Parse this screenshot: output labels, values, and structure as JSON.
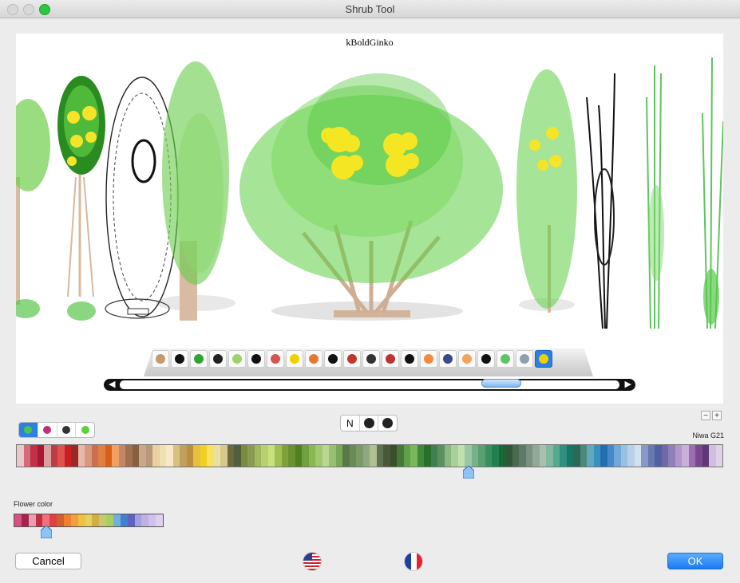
{
  "window": {
    "title": "Shrub Tool"
  },
  "preview": {
    "plant_name": "kBoldGinko"
  },
  "thumbnails": [
    {
      "icon": "twig-shrub-icon",
      "color": "#c49a6c"
    },
    {
      "icon": "black-bush-icon",
      "color": "#111111"
    },
    {
      "icon": "green-bush-icon",
      "color": "#2fa52f"
    },
    {
      "icon": "yellow-flower-black-bush-icon",
      "color": "#222222"
    },
    {
      "icon": "white-flower-bush-icon",
      "color": "#9ad36a"
    },
    {
      "icon": "black-silhouette-icon",
      "color": "#111111"
    },
    {
      "icon": "red-flower-shrub-icon",
      "color": "#d9534f"
    },
    {
      "icon": "yellow-flower-shrub-icon",
      "color": "#f0d000"
    },
    {
      "icon": "orange-flower-shrub-icon",
      "color": "#e07b2f"
    },
    {
      "icon": "black-tree-icon",
      "color": "#111111"
    },
    {
      "icon": "red-bloom-icon",
      "color": "#c0392b"
    },
    {
      "icon": "dark-tree-icon",
      "color": "#333333"
    },
    {
      "icon": "red-center-tree-icon",
      "color": "#b33"
    },
    {
      "icon": "black-round-tree-icon",
      "color": "#111111"
    },
    {
      "icon": "orange-bush-icon",
      "color": "#f08a3c"
    },
    {
      "icon": "dark-blue-bush-icon",
      "color": "#3a4a8a"
    },
    {
      "icon": "orange-dotted-bush-icon",
      "color": "#f2a35c"
    },
    {
      "icon": "black-twig-icon",
      "color": "#111111"
    },
    {
      "icon": "thin-green-stem-icon",
      "color": "#5ec45e"
    },
    {
      "icon": "thin-grey-stem-icon",
      "color": "#8f9fb0"
    },
    {
      "icon": "blue-selected-shrub-icon",
      "color": "#f0d000"
    }
  ],
  "selected_thumbnail": 20,
  "render_modes": [
    {
      "label": "N"
    },
    {
      "label": ""
    },
    {
      "label": ""
    }
  ],
  "zoom": {
    "minus": "−",
    "plus": "+"
  },
  "foliage_modes": [
    {
      "icon": "green-dot-icon",
      "color": "#49c44b",
      "selected": true
    },
    {
      "icon": "pink-dot-icon",
      "color": "#c0307a"
    },
    {
      "icon": "black-dot-icon",
      "color": "#333333"
    },
    {
      "icon": "light-green-dot-icon",
      "color": "#5fd03a"
    }
  ],
  "palette": {
    "name": "Niwa G21",
    "selected_fraction": 0.64,
    "colors": [
      "#e8c8c8",
      "#d46a7a",
      "#c03048",
      "#a81830",
      "#d8a0a0",
      "#b84040",
      "#e05050",
      "#c82020",
      "#9a2828",
      "#e8b8a8",
      "#d89880",
      "#c87050",
      "#e08040",
      "#d86018",
      "#f0a060",
      "#c08868",
      "#a07050",
      "#886040",
      "#c8a888",
      "#b89878",
      "#e8d0a0",
      "#f0e0b0",
      "#f8e8c8",
      "#d8c080",
      "#c0a060",
      "#b89040",
      "#e8c040",
      "#f0d020",
      "#f8e060",
      "#e8e0a0",
      "#d8c890",
      "#6a6a40",
      "#50603a",
      "#7a8a40",
      "#8a9a50",
      "#a0b860",
      "#b8d070",
      "#c8e080",
      "#a0c050",
      "#80a040",
      "#6a9030",
      "#508020",
      "#70a040",
      "#88b850",
      "#a0c870",
      "#b8d890",
      "#98c070",
      "#78a858",
      "#587848",
      "#6a8a58",
      "#7a9a68",
      "#90a880",
      "#b0c090",
      "#607050",
      "#485838",
      "#385028",
      "#487838",
      "#60a048",
      "#78b858",
      "#40883c",
      "#2a7028",
      "#408050",
      "#5a9060",
      "#8ab880",
      "#a8d098",
      "#c0e0b0",
      "#98c8a0",
      "#78b088",
      "#58a070",
      "#389060",
      "#208050",
      "#186838",
      "#305838",
      "#4a6a50",
      "#607868",
      "#789080",
      "#90a898",
      "#a8c0b0",
      "#80b8a0",
      "#58a890",
      "#309080",
      "#187868",
      "#2a6858",
      "#4a8878",
      "#60a8c0",
      "#3890c0",
      "#2070b0",
      "#4888c8",
      "#70a8d8",
      "#98c0e0",
      "#b8d0e8",
      "#d0e0f0",
      "#8898c8",
      "#6878b0",
      "#5060a0",
      "#7068a8",
      "#9080b8",
      "#b098c8",
      "#c8b0d8",
      "#9870b0",
      "#784890",
      "#603878",
      "#d0c0e0",
      "#e0d0e8"
    ]
  },
  "flower_color": {
    "label": "Flower color",
    "selected_fraction": 0.22,
    "colors": [
      "#d85080",
      "#a82050",
      "#e8a0b0",
      "#c03040",
      "#f07080",
      "#e04040",
      "#d06030",
      "#f08030",
      "#f0a040",
      "#f0c040",
      "#e8d060",
      "#d0b040",
      "#c8c870",
      "#a8d060",
      "#70b0e0",
      "#4080d0",
      "#6060c0",
      "#a0a0e0",
      "#c0b0e0",
      "#d0c0f0",
      "#e0d0f0"
    ]
  },
  "buttons": {
    "cancel": "Cancel",
    "ok": "OK"
  },
  "languages": [
    {
      "icon": "us-flag-icon"
    },
    {
      "icon": "french-flag-icon"
    }
  ]
}
